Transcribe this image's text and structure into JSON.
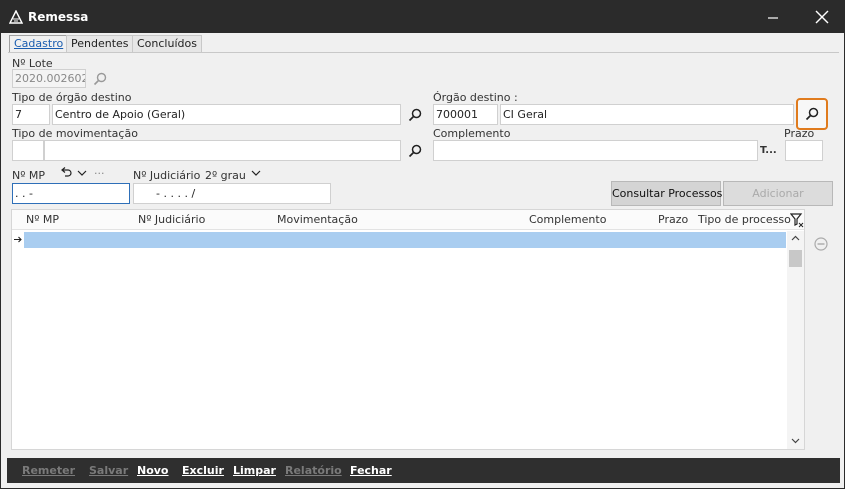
{
  "window": {
    "title": "Remessa"
  },
  "tabs": [
    {
      "label": "Cadastro"
    },
    {
      "label": "Pendentes"
    },
    {
      "label": "Concluídos"
    }
  ],
  "lote": {
    "label": "Nº Lote",
    "value": "2020.002602"
  },
  "tipo_orgao": {
    "label": "Tipo de órgão destino",
    "code": "7",
    "name": "Centro de Apoio (Geral)"
  },
  "orgao_destino": {
    "label": "Órgão destino :",
    "code": "700001",
    "name": "CI Geral"
  },
  "tipo_movimentacao": {
    "label": "Tipo de movimentação",
    "value": ""
  },
  "complemento": {
    "label": "Complemento",
    "value": "",
    "suffix": "T..."
  },
  "prazo": {
    "label": "Prazo",
    "value": ""
  },
  "mp": {
    "label": "Nº MP",
    "mask": ".   .      -",
    "more": "···"
  },
  "judiciario": {
    "label": "Nº Judiciário",
    "grau": "2º grau",
    "mask": "-  .   .  . .  /"
  },
  "buttons": {
    "consultar": "Consultar Processos",
    "adicionar": "Adicionar"
  },
  "grid": {
    "columns": [
      "Nº MP",
      "Nº Judiciário",
      "Movimentação",
      "Complemento",
      "Prazo",
      "Tipo de processo"
    ]
  },
  "footer": {
    "remeter": "Remeter",
    "salvar": "Salvar",
    "novo": "Novo",
    "excluir": "Excluir",
    "limpar": "Limpar",
    "relatorio": "Relatório",
    "fechar": "Fechar"
  },
  "colors": {
    "accent": "#1a5db0",
    "highlight": "#e07b1d",
    "selection": "#a9cdf0",
    "titlebar": "#2b2b2b"
  }
}
